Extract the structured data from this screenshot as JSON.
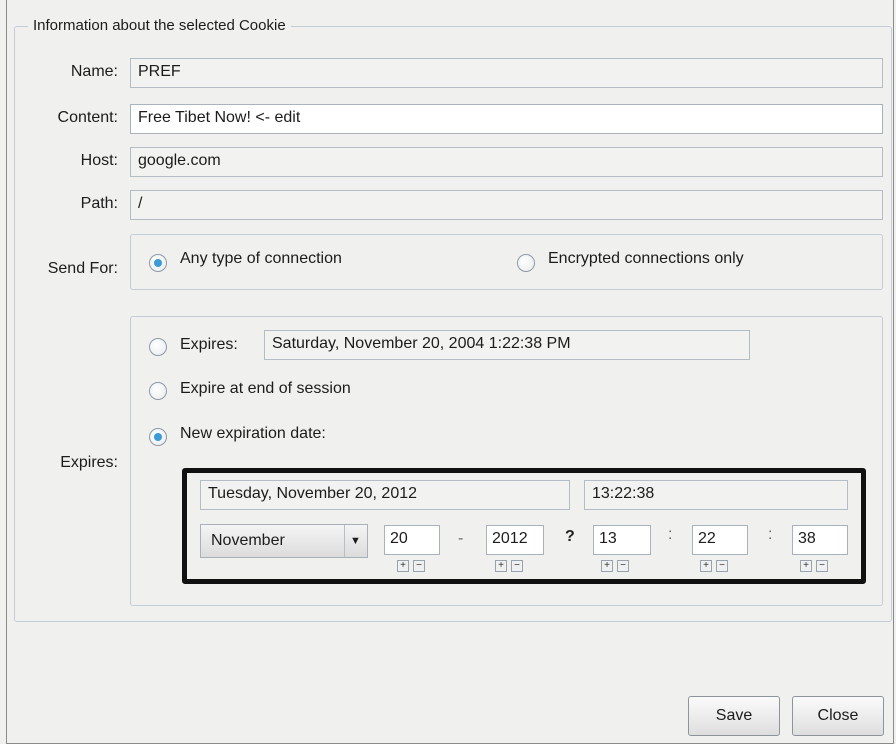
{
  "group": {
    "title": "Information about the selected Cookie"
  },
  "fields": {
    "name": {
      "label": "Name:",
      "value": "PREF"
    },
    "content": {
      "label": "Content:",
      "value": "Free Tibet Now! <- edit"
    },
    "host": {
      "label": "Host:",
      "value": "google.com"
    },
    "path": {
      "label": "Path:",
      "value": "/"
    }
  },
  "send_for": {
    "label": "Send For:",
    "options": [
      {
        "label": "Any type of connection",
        "selected": true
      },
      {
        "label": "Encrypted connections only",
        "selected": false
      }
    ]
  },
  "expires": {
    "label": "Expires:",
    "options": [
      {
        "label": "Expires:",
        "selected": false
      },
      {
        "label": "Expire at end of session",
        "selected": false
      },
      {
        "label": "New expiration date:",
        "selected": true
      }
    ],
    "current_value": "Saturday, November 20, 2004 1:22:38 PM",
    "new_date_display": "Tuesday, November 20, 2012",
    "new_time_display": "13:22:38",
    "month": "November",
    "day": "20",
    "year": "2012",
    "hour": "13",
    "minute": "22",
    "second": "38",
    "date_separator": "-",
    "mystery_separator": "?",
    "time_separator": ":",
    "plus": "+",
    "minus": "−"
  },
  "buttons": {
    "save": "Save",
    "close": "Close"
  },
  "colors": {
    "radio_selected": "#3c9ad6",
    "highlight_border": "#111111"
  }
}
